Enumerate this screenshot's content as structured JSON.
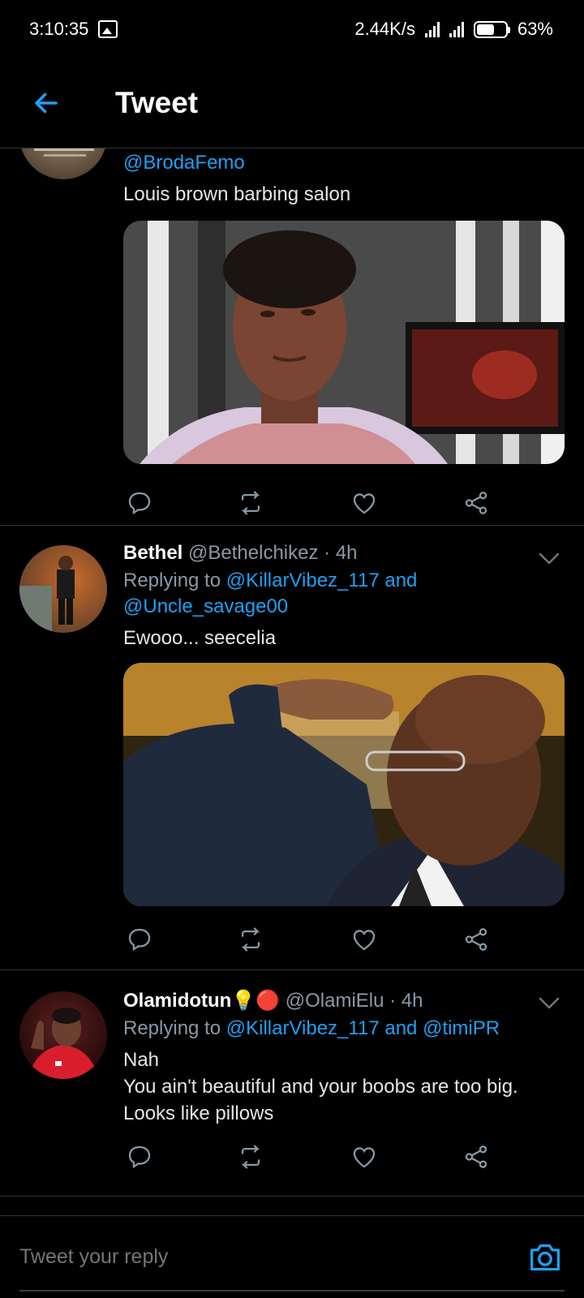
{
  "status_bar": {
    "time": "3:10:35",
    "network_speed": "2.44K/s",
    "battery_percent": "63%",
    "battery_level": 0.63,
    "icons": [
      "gallery-icon",
      "signal-icon",
      "signal-icon",
      "battery-icon"
    ]
  },
  "header": {
    "title": "Tweet",
    "back_icon": "arrow-left-icon"
  },
  "tweets": [
    {
      "reply_to": "@BrodaFemo",
      "text": "Louis brown barbing salon",
      "media": "photo"
    },
    {
      "name": "Bethel",
      "handle": "@Bethelchikez",
      "time": " · 4h",
      "replying_prefix": "Replying to ",
      "reply_to_1": "@KillarVibez_117",
      "reply_and": " and",
      "reply_to_2": "@Uncle_savage00",
      "text": "Ewooo...  seecelia",
      "media": "photo"
    },
    {
      "name": "Olamidotun",
      "name_emoji": "💡🔴",
      "handle": "@OlamiElu",
      "time": " · 4h",
      "replying_prefix": "Replying to ",
      "reply_to_1": "@KillarVibez_117",
      "reply_and": " and ",
      "reply_to_2": "@timiPR",
      "text_lines": [
        "Nah",
        "You ain't beautiful and your boobs are too big.",
        "Looks like pillows"
      ]
    }
  ],
  "actions": [
    "reply-icon",
    "retweet-icon",
    "like-icon",
    "share-icon"
  ],
  "reply_bar": {
    "placeholder": "Tweet your reply",
    "camera_icon": "camera-icon"
  },
  "colors": {
    "background": "#000000",
    "accent": "#1da1f2",
    "secondary_text": "#8899a6",
    "divider": "#2f3336"
  }
}
